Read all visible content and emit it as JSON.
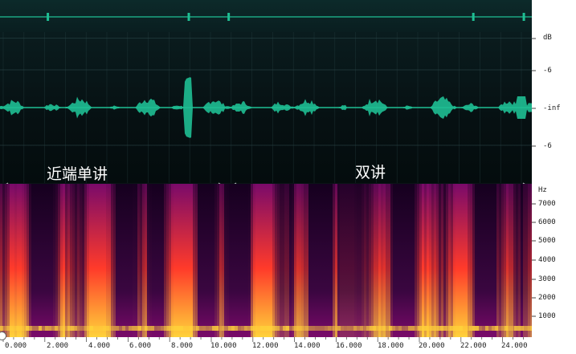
{
  "overview": {
    "markers": [
      0.09,
      0.355,
      0.43,
      0.89,
      0.985
    ]
  },
  "waveform": {
    "db_scale": [
      {
        "label": "dB",
        "level": 0.04
      },
      {
        "label": "-6",
        "level": 0.25
      },
      {
        "label": "-inf",
        "level": 0.5
      },
      {
        "label": "-6",
        "level": 0.75
      }
    ]
  },
  "annotations": {
    "near_end": "近端单讲",
    "double_talk": "双讲"
  },
  "spectrogram": {
    "unit": "Hz",
    "freq_labels": [
      "7000",
      "6000",
      "5000",
      "4000",
      "3000",
      "2000",
      "1000"
    ]
  },
  "timeline": {
    "labels": [
      "0.000",
      "2.000",
      "4.000",
      "6.000",
      "8.000",
      "10.000",
      "12.000",
      "14.000",
      "16.000",
      "18.000",
      "20.000",
      "22.000",
      "24.000"
    ]
  },
  "colors": {
    "wave": "#1fbf93",
    "grid": "#2a4648",
    "spectro_low": "#16001f",
    "spectro_mid": "#7a0a6a",
    "spectro_high": "#ff3a2a",
    "spectro_peak": "#ffd23a"
  }
}
